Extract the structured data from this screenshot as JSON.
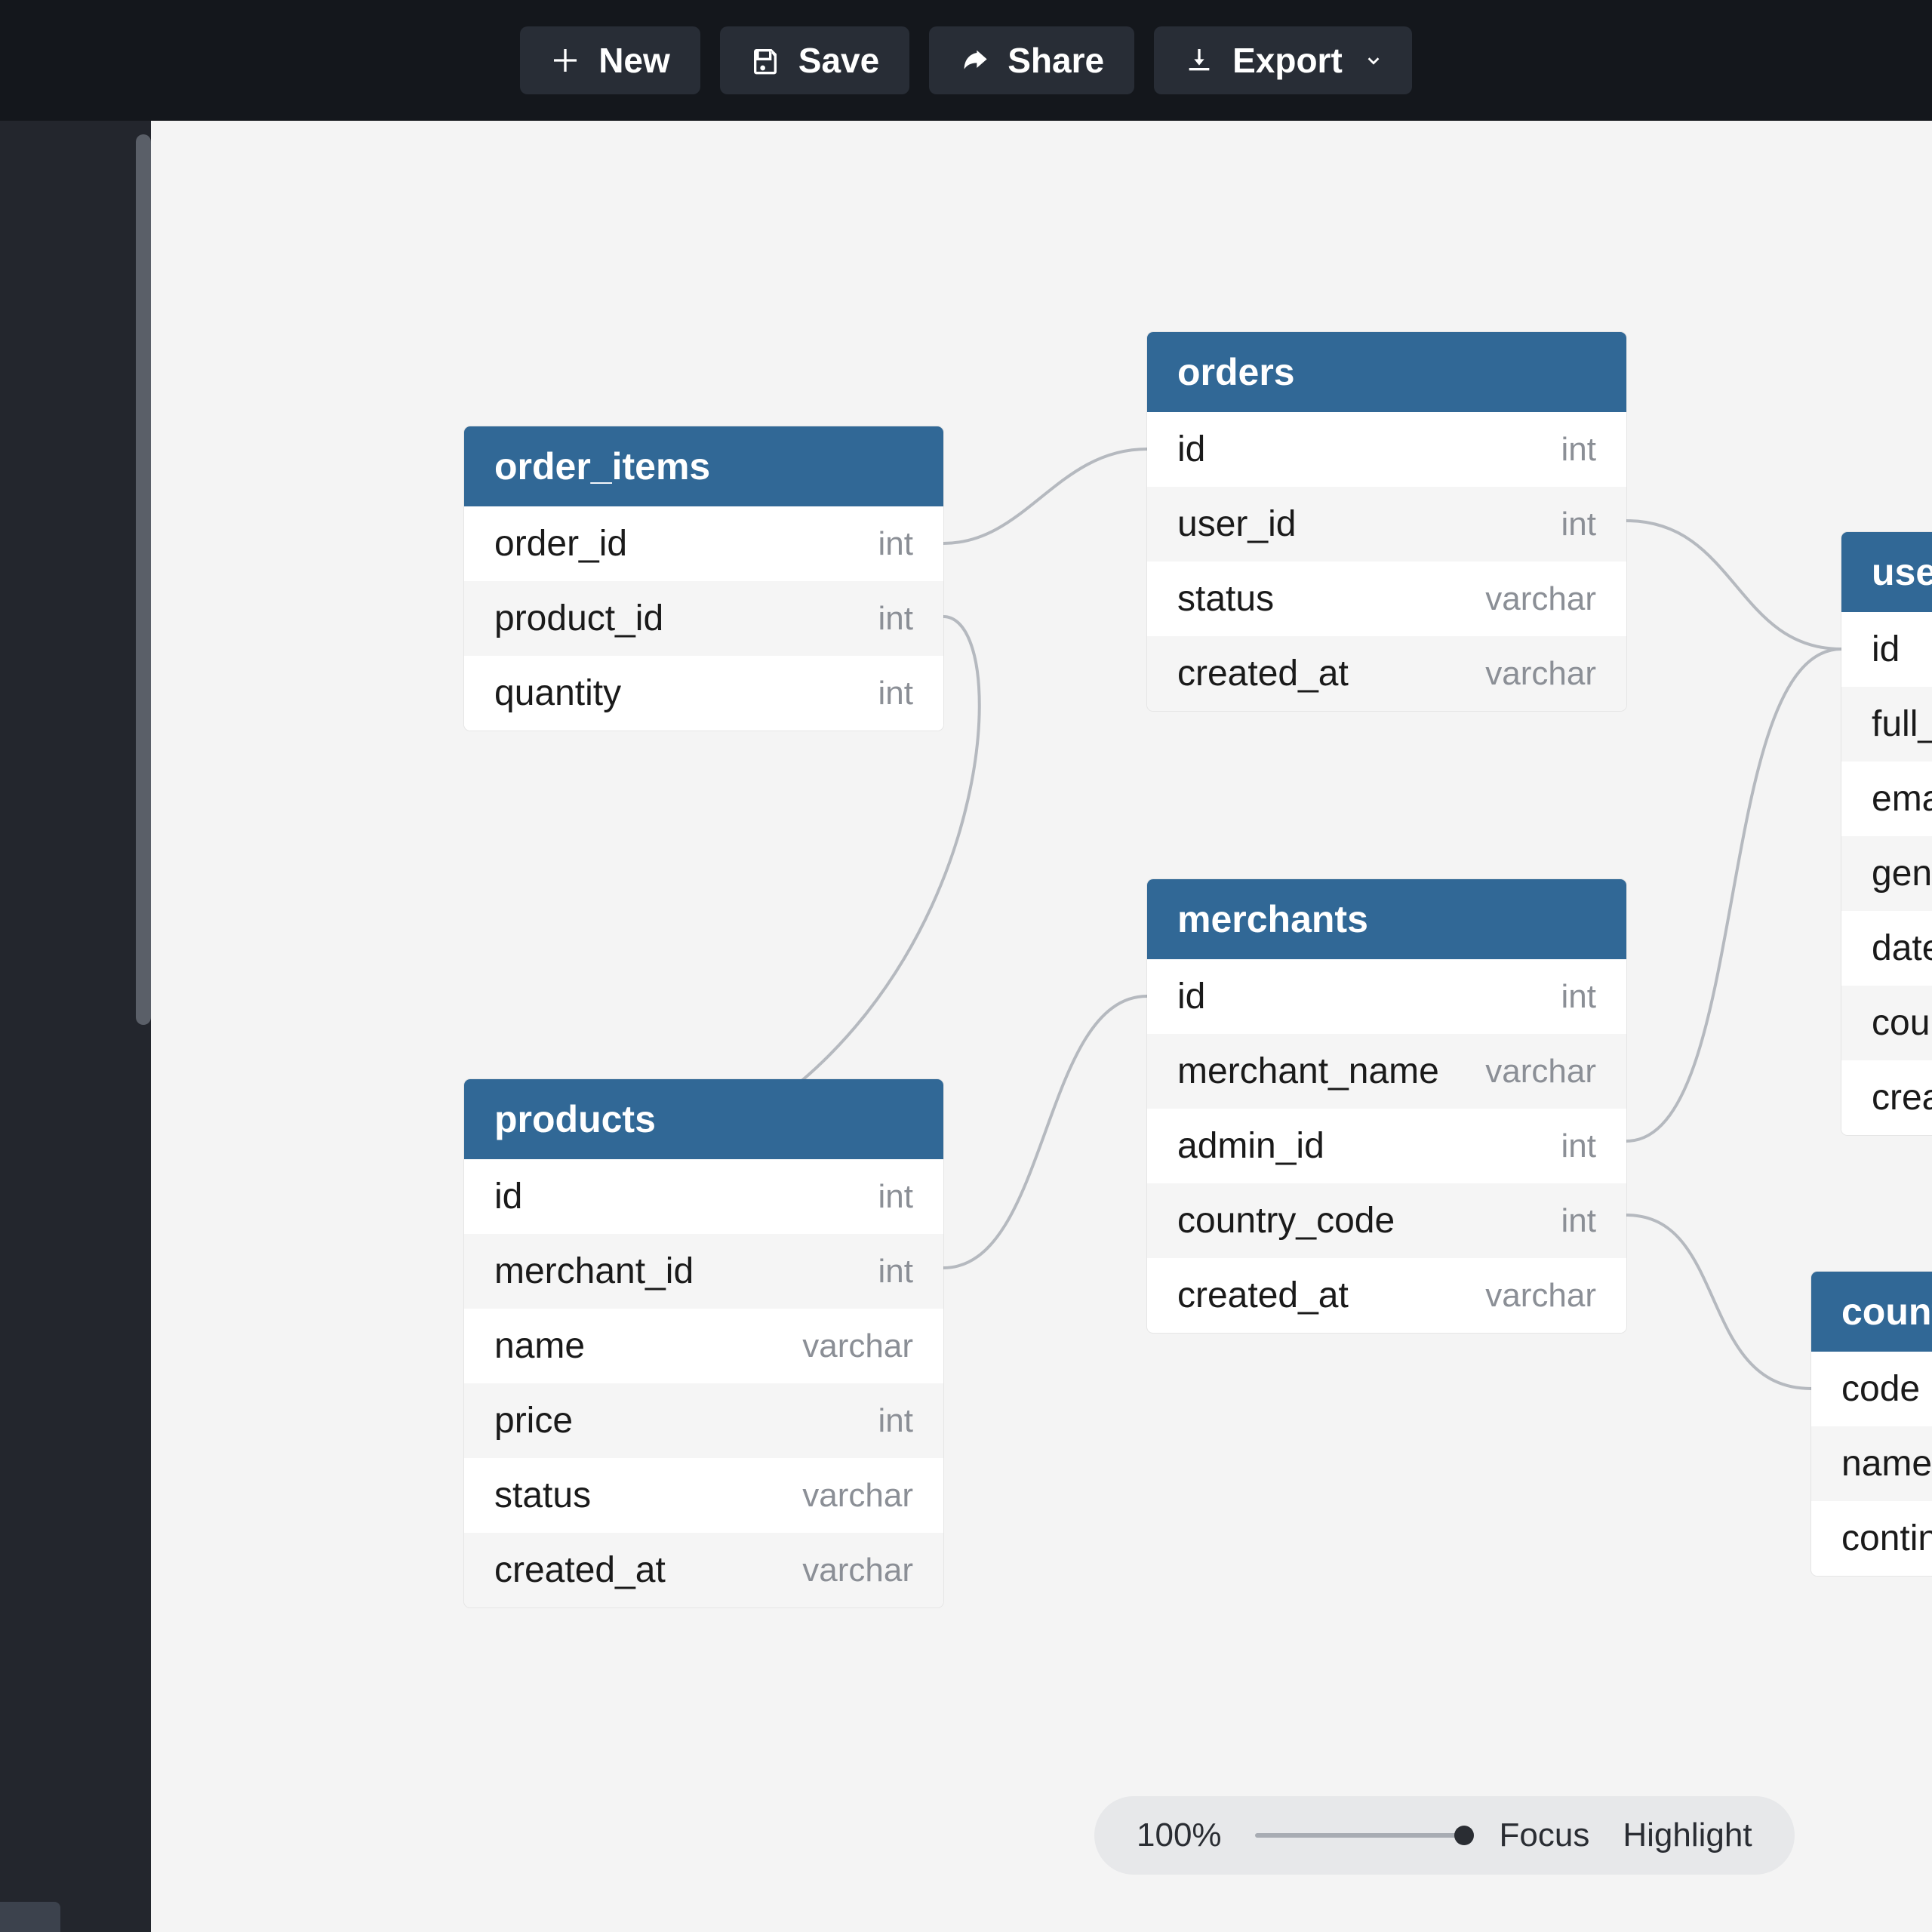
{
  "toolbar": {
    "new_label": "New",
    "save_label": "Save",
    "share_label": "Share",
    "export_label": "Export"
  },
  "tables": {
    "order_items": {
      "title": "order_items",
      "cols": [
        {
          "name": "order_id",
          "type": "int"
        },
        {
          "name": "product_id",
          "type": "int"
        },
        {
          "name": "quantity",
          "type": "int"
        }
      ]
    },
    "orders": {
      "title": "orders",
      "cols": [
        {
          "name": "id",
          "type": "int"
        },
        {
          "name": "user_id",
          "type": "int"
        },
        {
          "name": "status",
          "type": "varchar"
        },
        {
          "name": "created_at",
          "type": "varchar"
        }
      ]
    },
    "merchants": {
      "title": "merchants",
      "cols": [
        {
          "name": "id",
          "type": "int"
        },
        {
          "name": "merchant_name",
          "type": "varchar"
        },
        {
          "name": "admin_id",
          "type": "int"
        },
        {
          "name": "country_code",
          "type": "int"
        },
        {
          "name": "created_at",
          "type": "varchar"
        }
      ]
    },
    "products": {
      "title": "products",
      "cols": [
        {
          "name": "id",
          "type": "int"
        },
        {
          "name": "merchant_id",
          "type": "int"
        },
        {
          "name": "name",
          "type": "varchar"
        },
        {
          "name": "price",
          "type": "int"
        },
        {
          "name": "status",
          "type": "varchar"
        },
        {
          "name": "created_at",
          "type": "varchar"
        }
      ]
    },
    "users": {
      "title": "users",
      "cols": [
        {
          "name": "id",
          "type": ""
        },
        {
          "name": "full_name",
          "type": ""
        },
        {
          "name": "email",
          "type": ""
        },
        {
          "name": "gender",
          "type": ""
        },
        {
          "name": "date",
          "type": ""
        },
        {
          "name": "country",
          "type": ""
        },
        {
          "name": "created_at",
          "type": ""
        }
      ]
    },
    "countries": {
      "title": "countries",
      "cols": [
        {
          "name": "code",
          "type": ""
        },
        {
          "name": "name",
          "type": ""
        },
        {
          "name": "continent",
          "type": ""
        }
      ]
    }
  },
  "zoom": {
    "level": "100%",
    "focus_label": "Focus",
    "highlight_label": "Highlight"
  }
}
